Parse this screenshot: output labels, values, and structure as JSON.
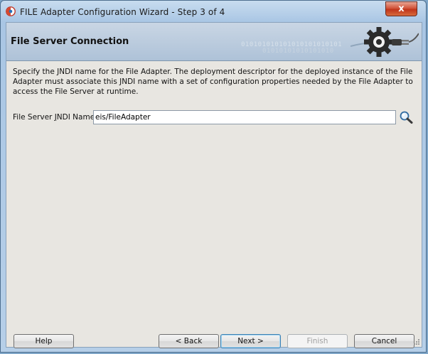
{
  "window": {
    "title": "FILE Adapter Configuration Wizard - Step 3 of 4",
    "close_glyph": "x"
  },
  "header": {
    "title": "File Server Connection",
    "decoration_line1": "010101010101010101010101",
    "decoration_line2": "01010101010101010"
  },
  "main": {
    "description": "Specify the JNDI name for the File Adapter. The deployment descriptor for the deployed instance of the File Adapter must associate this JNDI name with a set of configuration properties needed by the File Adapter to access the File Server at runtime.",
    "jndi_label_pre": "File Server ",
    "jndi_label_mnemonic": "J",
    "jndi_label_post": "NDI Name",
    "jndi_value": "eis/FileAdapter"
  },
  "footer": {
    "help": "Help",
    "back": "< Back",
    "next": "Next >",
    "finish": "Finish",
    "cancel": "Cancel"
  },
  "icons": {
    "app": "oracle-icon",
    "header": "gear-plug-icon",
    "search": "search-icon"
  }
}
